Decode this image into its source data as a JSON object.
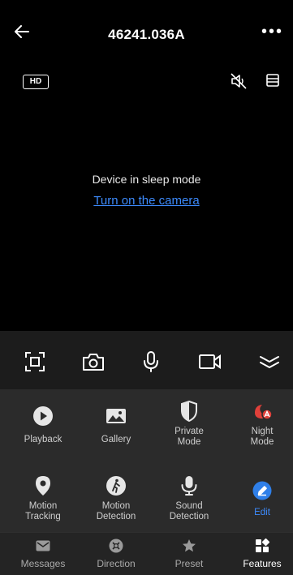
{
  "header": {
    "title": "46241.036A",
    "more_label": "•••"
  },
  "video": {
    "hd_label": "HD",
    "sleep_message": "Device in sleep mode",
    "wake_link": "Turn on the camera"
  },
  "controls": [
    "screenshot-frame-icon",
    "camera-icon",
    "microphone-icon",
    "record-video-icon",
    "collapse-icon"
  ],
  "features": {
    "row1": [
      {
        "label": "Playback",
        "icon": "play-icon"
      },
      {
        "label": "Gallery",
        "icon": "image-icon"
      },
      {
        "label": "Private\nMode",
        "icon": "shield-icon"
      },
      {
        "label": "Night\nMode",
        "icon": "night-mode-icon"
      }
    ],
    "row2": [
      {
        "label": "Motion\nTracking",
        "icon": "location-pin-icon"
      },
      {
        "label": "Motion\nDetection",
        "icon": "walking-person-icon"
      },
      {
        "label": "Sound\nDetection",
        "icon": "microphone-icon"
      },
      {
        "label": "Edit",
        "icon": "edit-pencil-icon"
      }
    ]
  },
  "tabs": [
    {
      "label": "Messages",
      "icon": "envelope-icon",
      "active": false
    },
    {
      "label": "Direction",
      "icon": "direction-pad-icon",
      "active": false
    },
    {
      "label": "Preset",
      "icon": "star-icon",
      "active": false
    },
    {
      "label": "Features",
      "icon": "grid-icon",
      "active": true
    }
  ],
  "colors": {
    "link": "#3d8bfd",
    "night_mode_accent": "#e0403a",
    "edit_accent": "#2f7fe8",
    "panel": "#2b2b2b",
    "background": "#000000"
  }
}
